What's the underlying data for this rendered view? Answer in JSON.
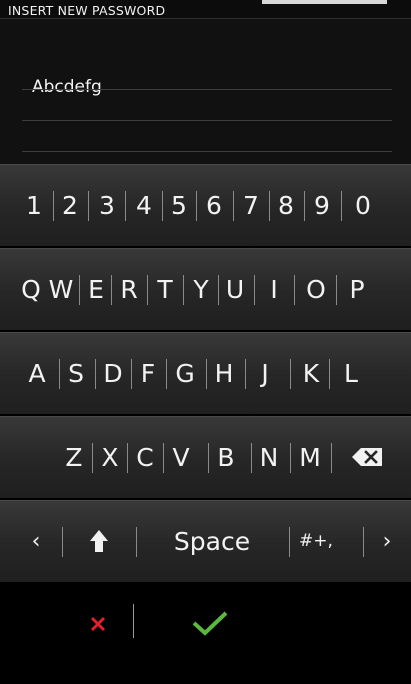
{
  "title": "INSERT NEW PASSWORD",
  "password_field": {
    "value": "Abcdefg"
  },
  "keyboard": {
    "row_numbers": [
      "1",
      "2",
      "3",
      "4",
      "5",
      "6",
      "7",
      "8",
      "9",
      "0"
    ],
    "row_qwerty": [
      "Q",
      "W",
      "E",
      "R",
      "T",
      "Y",
      "U",
      "I",
      "O",
      "P"
    ],
    "row_asdf": [
      "A",
      "S",
      "D",
      "F",
      "G",
      "H",
      "J",
      "K",
      "L"
    ],
    "row_zxcv": [
      "Z",
      "X",
      "C",
      "V",
      "B",
      "N",
      "M"
    ],
    "function_row": {
      "left_glyph": "‹",
      "shift_glyph": "⬆",
      "space_label": "Space",
      "symbols_label": "#+,",
      "right_glyph": "›"
    }
  },
  "actions": {
    "cancel_glyph": "✕",
    "confirm_glyph": "✓"
  },
  "colors": {
    "cancel": "#e0202a",
    "confirm": "#5ab83c"
  }
}
